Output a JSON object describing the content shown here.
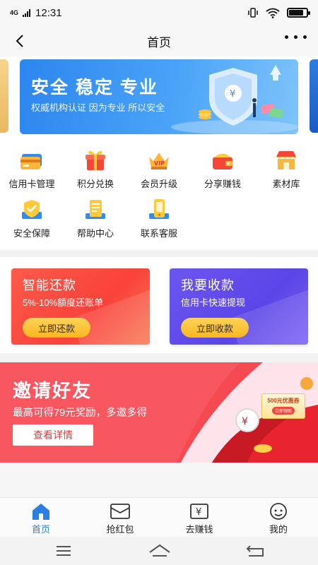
{
  "status_bar": {
    "network": "4G",
    "time": "12:31",
    "battery_level": 0.85
  },
  "nav": {
    "title": "首页"
  },
  "banner": {
    "title": "安全 稳定 专业",
    "subtitle": "权威机构认证 因为专业 所以安全"
  },
  "grid": {
    "items": [
      {
        "label": "信用卡管理",
        "icon": "credit-card-icon"
      },
      {
        "label": "积分兑换",
        "icon": "gift-icon"
      },
      {
        "label": "会员升级",
        "icon": "vip-icon"
      },
      {
        "label": "分享赚钱",
        "icon": "share-wallet-icon"
      },
      {
        "label": "素材库",
        "icon": "store-icon"
      },
      {
        "label": "安全保障",
        "icon": "shield-check-icon"
      },
      {
        "label": "帮助中心",
        "icon": "help-doc-icon"
      },
      {
        "label": "联系客服",
        "icon": "phone-service-icon"
      }
    ]
  },
  "cards": [
    {
      "title": "智能还款",
      "subtitle": "5%-10%额度还账单",
      "button": "立即还款",
      "color": "#f9423a"
    },
    {
      "title": "我要收款",
      "subtitle": "信用卡快速提现",
      "button": "立即收款",
      "color": "#5a45e6"
    }
  ],
  "invite": {
    "title": "邀请好友",
    "subtitle": "最高可得79元奖励，多邀多得",
    "button": "查看详情",
    "coupon": {
      "value": "500元优惠券",
      "action": "立即领取"
    }
  },
  "tabbar": {
    "items": [
      {
        "label": "首页",
        "icon": "home-icon",
        "active": true
      },
      {
        "label": "抢红包",
        "icon": "red-envelope-icon",
        "active": false
      },
      {
        "label": "去赚钱",
        "icon": "earn-money-icon",
        "active": false
      },
      {
        "label": "我的",
        "icon": "profile-icon",
        "active": false
      }
    ]
  },
  "colors": {
    "accent": "#2a7fe0",
    "banner_blue": "#2c86ee",
    "card_red": "#f9423a",
    "card_purple": "#5a45e6",
    "button_yellow": "#f9b71d",
    "invite_red": "#e1373a"
  }
}
